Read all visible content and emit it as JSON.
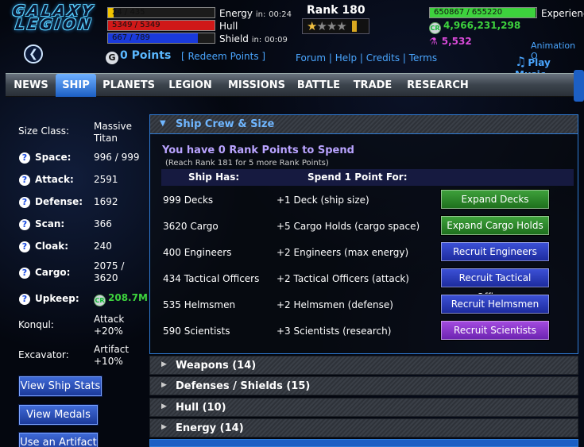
{
  "logo": {
    "line1": "GALAXY",
    "line2": "LEGION"
  },
  "header": {
    "energy": {
      "value": "24 / 435",
      "label": "Energy",
      "timer_prefix": "in:",
      "timer": "00:24",
      "fill_fraction": 0.055,
      "color": "#f2c400"
    },
    "hull": {
      "value": "5349 / 5349",
      "label": "Hull",
      "fill_fraction": 1.0,
      "color": "#d01818"
    },
    "shield": {
      "value": "667 / 789",
      "label": "Shield",
      "timer_prefix": "in:",
      "timer": "00:09",
      "fill_fraction": 0.845,
      "color": "#1a3adb"
    },
    "gpoints": {
      "icon": "g-points-icon",
      "text": "0 Points"
    },
    "redeem": "[ Redeem Points ]",
    "rank": {
      "label": "Rank 180",
      "stars_filled": 1,
      "stars_total": 4
    },
    "links": [
      "Forum",
      "Help",
      "Credits",
      "Terms"
    ],
    "experience": {
      "value": "650867 / 655220",
      "label": "Experienc",
      "fill_fraction": 0.993,
      "color": "#3dd23d"
    },
    "credits": "4,966,231,298",
    "elements": "5,532",
    "animation": "Animation O",
    "music": "Play Music"
  },
  "nav": {
    "items": [
      "NEWS",
      "SHIP",
      "PLANETS",
      "LEGION",
      "MISSIONS",
      "BATTLE",
      "TRADE",
      "RESEARCH"
    ],
    "active": "SHIP"
  },
  "sidebar": {
    "size_class": {
      "label": "Size Class:",
      "value": "Massive Titan"
    },
    "space": {
      "label": "Space:",
      "value": "996 / 999"
    },
    "attack": {
      "label": "Attack:",
      "value": "2591"
    },
    "defense": {
      "label": "Defense:",
      "value": "1692"
    },
    "scan": {
      "label": "Scan:",
      "value": "366"
    },
    "cloak": {
      "label": "Cloak:",
      "value": "240"
    },
    "cargo": {
      "label": "Cargo:",
      "value": "2075 / 3620"
    },
    "upkeep": {
      "label": "Upkeep:",
      "value": "208.7M"
    },
    "konqul": {
      "label": "Konqul:",
      "value": "Attack +20%"
    },
    "excavator": {
      "label": "Excavator:",
      "value": "Artifact +10%"
    },
    "buttons": [
      "View Ship Stats",
      "View Medals",
      "Use an Artifact"
    ]
  },
  "crew": {
    "title": "Ship Crew & Size",
    "spend": "You have 0 Rank Points to Spend",
    "reach": "(Reach Rank 181 for 5 more Rank Points)",
    "col_has": "Ship Has:",
    "col_spend": "Spend 1 Point For:",
    "rows": [
      {
        "has": "999 Decks",
        "effect": "+1 Deck (ship size)",
        "button": "Expand Decks",
        "color": "green"
      },
      {
        "has": "3620 Cargo",
        "effect": "+5 Cargo Holds (cargo space)",
        "button": "Expand Cargo Holds",
        "color": "green"
      },
      {
        "has": "400 Engineers",
        "effect": "+2 Engineers (max energy)",
        "button": "Recruit Engineers",
        "color": "blue"
      },
      {
        "has": "434 Tactical Officers",
        "effect": "+2 Tactical Officers (attack)",
        "button": "Recruit Tactical Officers",
        "color": "blue"
      },
      {
        "has": "535 Helmsmen",
        "effect": "+2 Helmsmen (defense)",
        "button": "Recruit Helmsmen",
        "color": "blue"
      },
      {
        "has": "590 Scientists",
        "effect": "+3 Scientists (research)",
        "button": "Recruit Scientists",
        "color": "purple"
      }
    ]
  },
  "sections": [
    "Weapons (14)",
    "Defenses / Shields (15)",
    "Hull (10)",
    "Energy (14)"
  ]
}
